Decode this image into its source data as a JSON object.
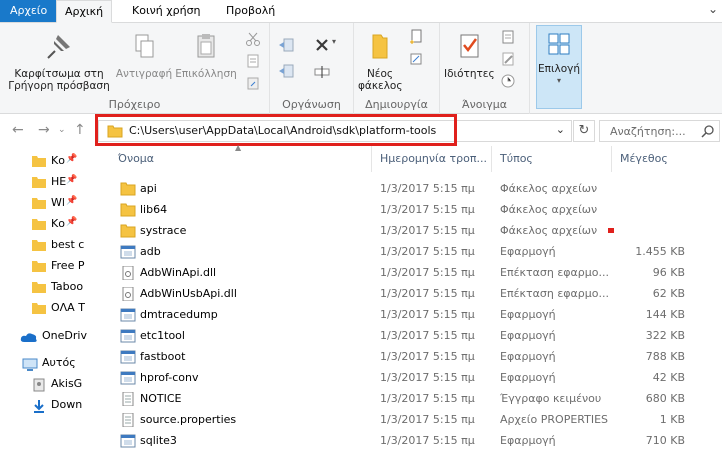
{
  "tabs": {
    "file": "Αρχείο",
    "home": "Αρχική",
    "share": "Κοινή χρήση",
    "view": "Προβολή"
  },
  "ribbon": {
    "clipboard": {
      "group_label": "Πρόχειρο",
      "pin_label": "Καρφίτσωμα στη Γρήγορη πρόσβαση",
      "copy_label": "Αντιγραφή",
      "paste_label": "Επικόλληση"
    },
    "organize": {
      "group_label": "Οργάνωση"
    },
    "new": {
      "group_label": "Δημιουργία",
      "new_folder_label": "Νέος φάκελος"
    },
    "open": {
      "group_label": "Άνοιγμα",
      "properties_label": "Ιδιότητες"
    },
    "select": {
      "select_label": "Επιλογή"
    }
  },
  "address": {
    "path": "C:\\Users\\user\\AppData\\Local\\Android\\sdk\\platform-tools",
    "search_placeholder": "Αναζήτηση:..."
  },
  "nav": {
    "items": [
      {
        "label": "Κο",
        "pinned": true
      },
      {
        "label": "ΗΕ",
        "pinned": true
      },
      {
        "label": "Wl",
        "pinned": true
      },
      {
        "label": "Κο",
        "pinned": true
      },
      {
        "label": "best c",
        "pinned": false
      },
      {
        "label": "Free P",
        "pinned": false
      },
      {
        "label": "Taboo",
        "pinned": false
      },
      {
        "label": "ΟΛΑ Τ",
        "pinned": false
      }
    ],
    "onedrive": "OneDriv",
    "thispc": "Αυτός",
    "akis": "AkisG",
    "downloads": "Down"
  },
  "columns": {
    "name": "Όνομα",
    "date": "Ημερομηνία τροπ...",
    "type": "Τύπος",
    "size": "Μέγεθος"
  },
  "files": [
    {
      "name": "api",
      "date": "1/3/2017 5:15 πμ",
      "type": "Φάκελος αρχείων",
      "size": "",
      "kind": "folder"
    },
    {
      "name": "lib64",
      "date": "1/3/2017 5:15 πμ",
      "type": "Φάκελος αρχείων",
      "size": "",
      "kind": "folder"
    },
    {
      "name": "systrace",
      "date": "1/3/2017 5:15 πμ",
      "type": "Φάκελος αρχείων",
      "size": "",
      "kind": "folder"
    },
    {
      "name": "adb",
      "date": "1/3/2017 5:15 πμ",
      "type": "Εφαρμογή",
      "size": "1.455 KB",
      "kind": "exe"
    },
    {
      "name": "AdbWinApi.dll",
      "date": "1/3/2017 5:15 πμ",
      "type": "Επέκταση εφαρμο...",
      "size": "96 KB",
      "kind": "dll"
    },
    {
      "name": "AdbWinUsbApi.dll",
      "date": "1/3/2017 5:15 πμ",
      "type": "Επέκταση εφαρμο...",
      "size": "62 KB",
      "kind": "dll"
    },
    {
      "name": "dmtracedump",
      "date": "1/3/2017 5:15 πμ",
      "type": "Εφαρμογή",
      "size": "144 KB",
      "kind": "exe"
    },
    {
      "name": "etc1tool",
      "date": "1/3/2017 5:15 πμ",
      "type": "Εφαρμογή",
      "size": "322 KB",
      "kind": "exe"
    },
    {
      "name": "fastboot",
      "date": "1/3/2017 5:15 πμ",
      "type": "Εφαρμογή",
      "size": "788 KB",
      "kind": "exe"
    },
    {
      "name": "hprof-conv",
      "date": "1/3/2017 5:15 πμ",
      "type": "Εφαρμογή",
      "size": "42 KB",
      "kind": "exe"
    },
    {
      "name": "NOTICE",
      "date": "1/3/2017 5:15 πμ",
      "type": "Έγγραφο κειμένου",
      "size": "680 KB",
      "kind": "txt"
    },
    {
      "name": "source.properties",
      "date": "1/3/2017 5:15 πμ",
      "type": "Αρχείο PROPERTIES",
      "size": "1 KB",
      "kind": "txt"
    },
    {
      "name": "sqlite3",
      "date": "1/3/2017 5:15 πμ",
      "type": "Εφαρμογή",
      "size": "710 KB",
      "kind": "exe"
    }
  ],
  "colors": {
    "file_tab": "#1979ca",
    "highlight": "#e0201c",
    "folder": "#f5c342"
  }
}
